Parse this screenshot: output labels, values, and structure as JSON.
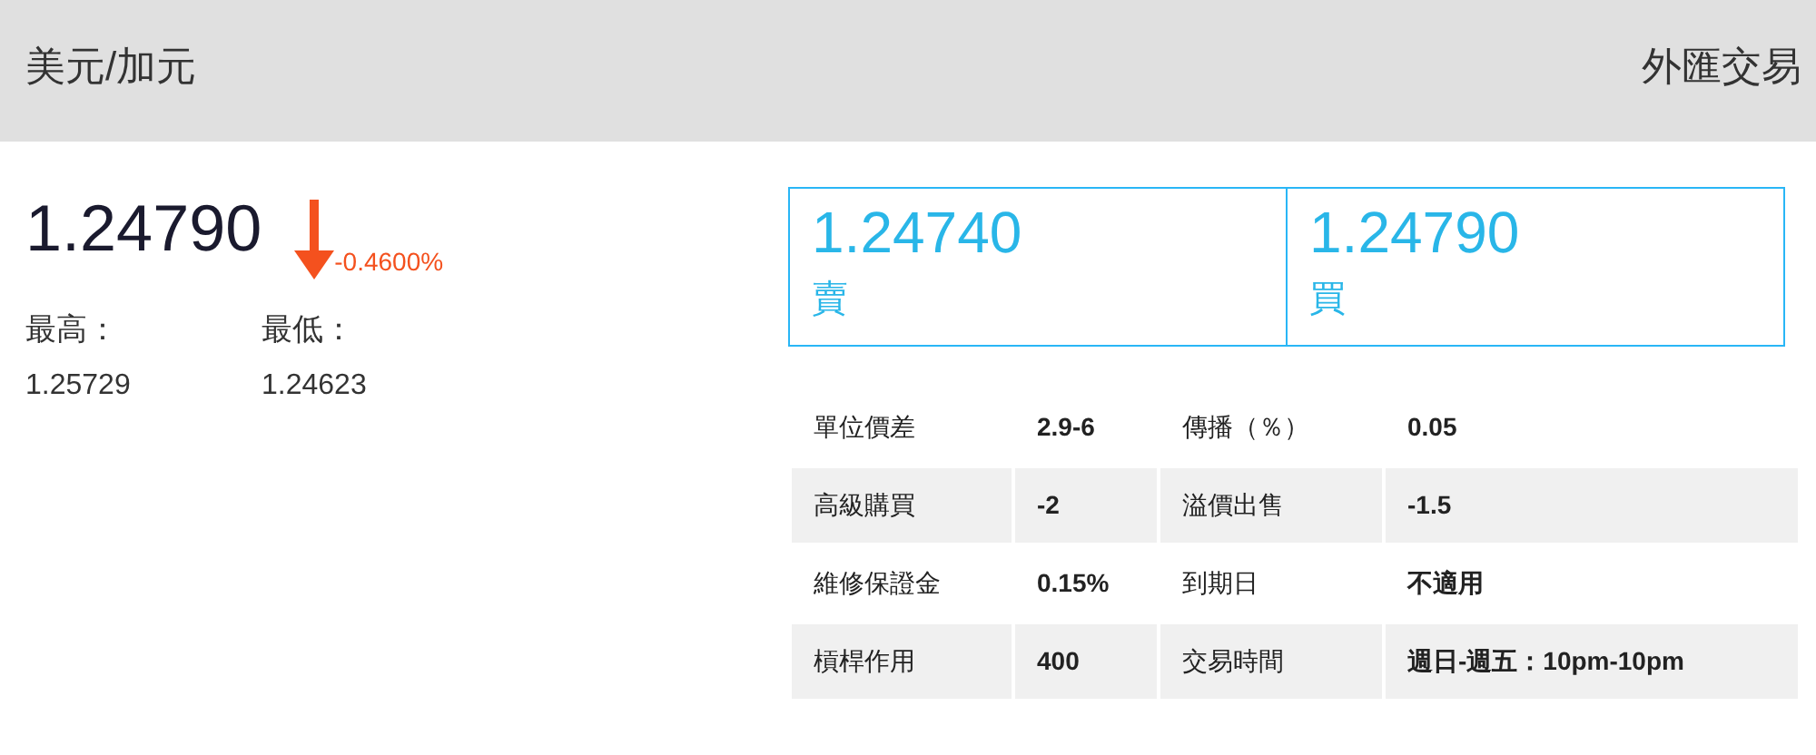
{
  "header": {
    "title": "美元/加元",
    "category": "外匯交易"
  },
  "quote": {
    "price": "1.24790",
    "falling": true,
    "change": "-0.4600%",
    "high_label": "最高：",
    "high": "1.25729",
    "low_label": "最低：",
    "low": "1.24623"
  },
  "prices": [
    {
      "value": "1.24740",
      "label": "賣"
    },
    {
      "value": "1.24790",
      "label": "買"
    }
  ],
  "details": [
    {
      "label": "單位價差",
      "value": "2.9-6",
      "label_2": "傳播（％）",
      "value_2": "0.05"
    },
    {
      "label": "高級購買",
      "value": "-2",
      "label_2": "溢價出售",
      "value_2": "-1.5"
    },
    {
      "label": "維修保證金",
      "value": "0.15%",
      "label_2": "到期日",
      "value_2": "不適用"
    },
    {
      "label": "槓桿作用",
      "value": "400",
      "label_2": "交易時間",
      "value_2": "週日-週五：10pm-10pm"
    }
  ]
}
